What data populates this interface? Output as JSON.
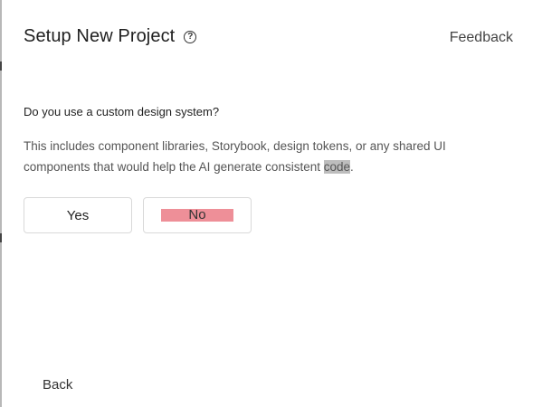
{
  "header": {
    "title": "Setup New Project",
    "help_icon": "question-circle-icon",
    "feedback_label": "Feedback"
  },
  "question": {
    "text": "Do you use a custom design system?"
  },
  "description": {
    "text_before": "This includes component libraries, Storybook, design tokens, or any shared UI components that would help the AI generate consistent ",
    "highlighted_word": "code",
    "text_after": "."
  },
  "options": {
    "yes_label": "Yes",
    "no_label": "No"
  },
  "footer": {
    "back_label": "Back"
  },
  "colors": {
    "no_highlight": "#ee8f98",
    "text_highlight": "#bdbdbd"
  }
}
